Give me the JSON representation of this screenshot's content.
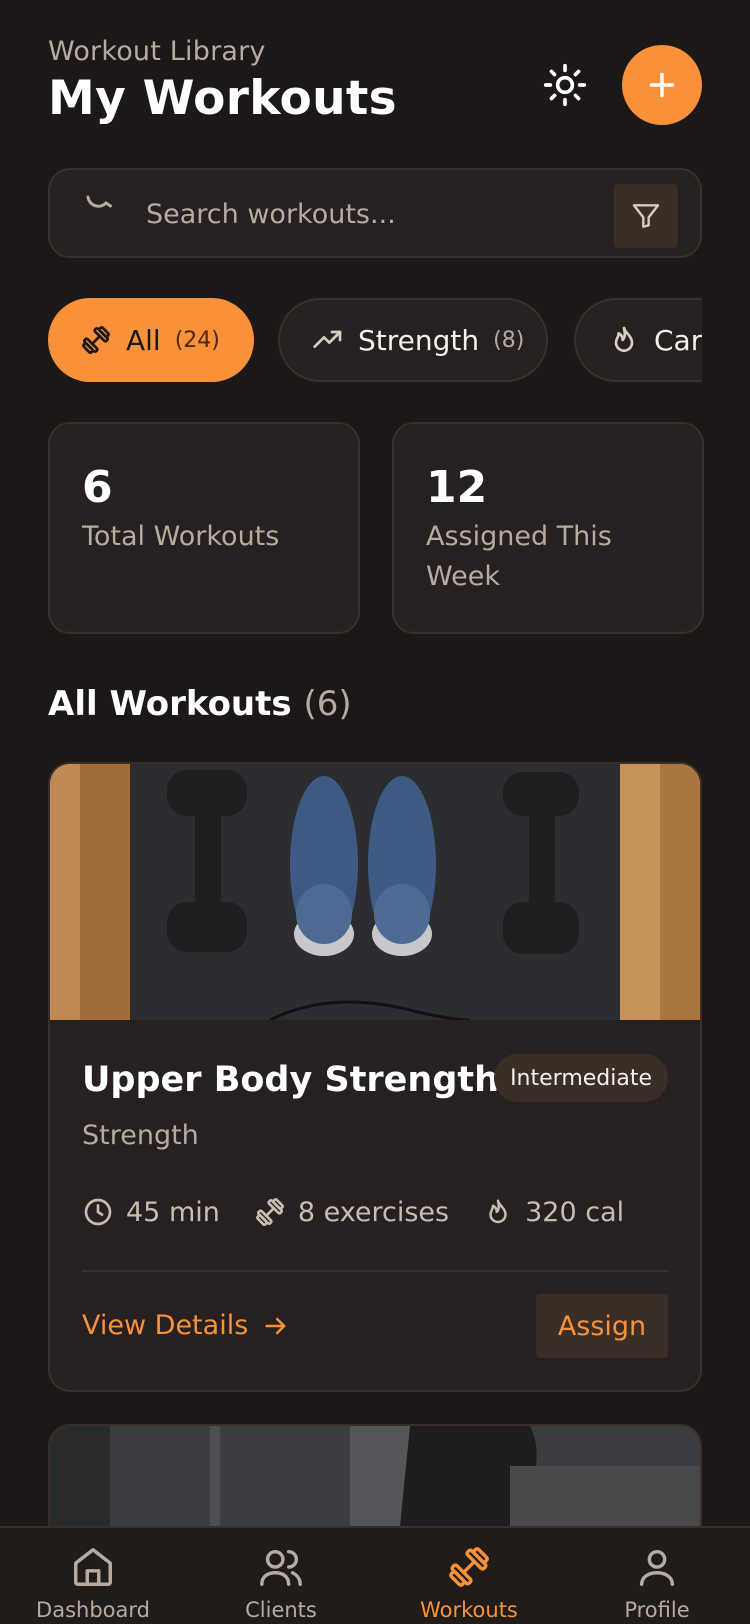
{
  "header": {
    "subtitle": "Workout Library",
    "title": "My Workouts"
  },
  "search": {
    "placeholder": "Search workouts..."
  },
  "chips": [
    {
      "label": "All",
      "count": "(24)"
    },
    {
      "label": "Strength",
      "count": "(8)"
    },
    {
      "label": "Cardio",
      "count": ""
    }
  ],
  "stats": [
    {
      "value": "6",
      "label": "Total Workouts"
    },
    {
      "value": "12",
      "label": "Assigned This Week"
    }
  ],
  "section": {
    "title": "All Workouts",
    "count": "(6)"
  },
  "workout": {
    "title": "Upper Body Strength",
    "level": "Intermediate",
    "category": "Strength",
    "duration": "45 min",
    "exercises": "8 exercises",
    "calories": "320 cal",
    "view_label": "View Details",
    "assign_label": "Assign"
  },
  "nav": [
    {
      "label": "Dashboard"
    },
    {
      "label": "Clients"
    },
    {
      "label": "Workouts"
    },
    {
      "label": "Profile"
    }
  ],
  "colors": {
    "accent": "#f9913a",
    "background": "#1c1817",
    "card": "#262120"
  }
}
